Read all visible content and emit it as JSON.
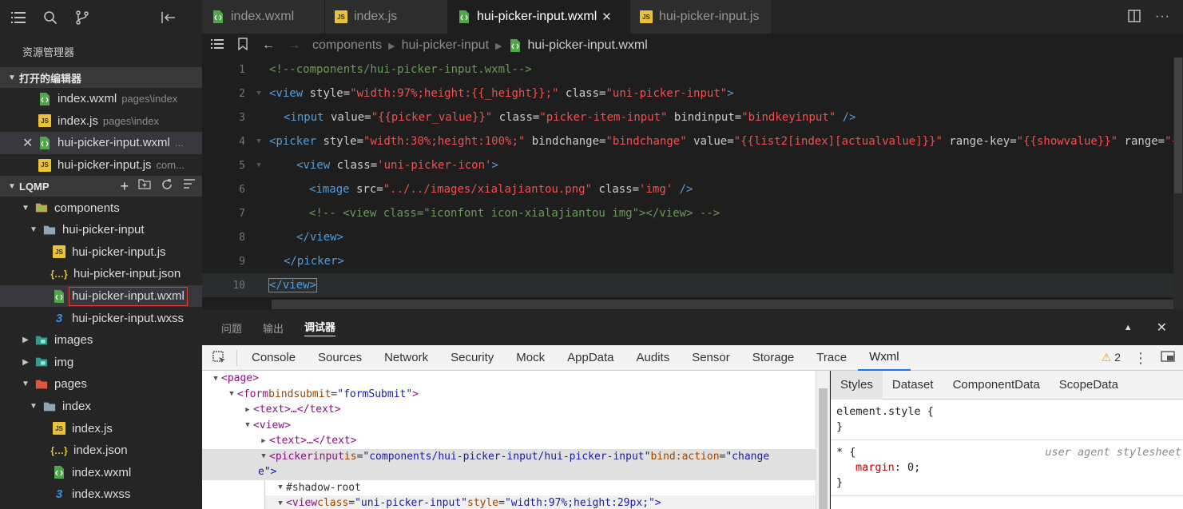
{
  "sidebar": {
    "title": "资源管理器",
    "open_editors_label": "打开的编辑器",
    "open_editors": [
      {
        "name": "index.wxml",
        "path": "pages\\index",
        "icon": "wxml-file-icon"
      },
      {
        "name": "index.js",
        "path": "pages\\index",
        "icon": "js-file-icon"
      },
      {
        "name": "hui-picker-input.wxml",
        "path": "...",
        "icon": "wxml-file-icon",
        "selected": true
      },
      {
        "name": "hui-picker-input.js",
        "path": "com...",
        "icon": "js-file-icon"
      }
    ],
    "project_label": "LQMP",
    "tree": [
      {
        "name": "components",
        "type": "folder"
      },
      {
        "name": "hui-picker-input",
        "type": "folder"
      },
      {
        "name": "hui-picker-input.js"
      },
      {
        "name": "hui-picker-input.json"
      },
      {
        "name": "hui-picker-input.wxml"
      },
      {
        "name": "hui-picker-input.wxss"
      },
      {
        "name": "images",
        "type": "folder"
      },
      {
        "name": "img",
        "type": "folder"
      },
      {
        "name": "pages",
        "type": "folder"
      },
      {
        "name": "index",
        "type": "folder"
      },
      {
        "name": "index.js"
      },
      {
        "name": "index.json"
      },
      {
        "name": "index.wxml"
      },
      {
        "name": "index.wxss"
      }
    ]
  },
  "tabs": [
    {
      "label": "index.wxml"
    },
    {
      "label": "index.js"
    },
    {
      "label": "hui-picker-input.wxml",
      "active": true
    },
    {
      "label": "hui-picker-input.js"
    }
  ],
  "breadcrumb": [
    "components",
    "hui-picker-input",
    "hui-picker-input.wxml"
  ],
  "code": {
    "line_numbers": [
      "1",
      "2",
      "3",
      "4",
      "5",
      "6",
      "7",
      "8",
      "9",
      "10"
    ],
    "l1": "<!--components/hui-picker-input.wxml-->",
    "l2": {
      "tag": "<view",
      "a1": " style=",
      "v1": "\"width:97%;height:{{_height}};\"",
      "a2": " class=",
      "v2": "\"uni-picker-input\"",
      "end": ">"
    },
    "l3": {
      "tag": "<input",
      "a1": " value=",
      "v1": "\"{{picker_value}}\"",
      "a2": " class=",
      "v2": "\"picker-item-input\"",
      "a3": " bindinput=",
      "v3": "\"bindkeyinput\"",
      "end": " />"
    },
    "l4": {
      "tag": "<picker",
      "a1": " style=",
      "v1": "\"width:30%;height:100%;\"",
      "a2": " bindchange=",
      "v2": "\"bindchange\"",
      "a3": " value=",
      "v3": "\"{{list2[index][actualvalue]}}\"",
      "a4": " range-key=",
      "v4": "\"{{showvalue}}\"",
      "a5": " range=",
      "v5": "\"{{l"
    },
    "l5": {
      "tag": "<view",
      "a1": " class=",
      "v1": "'uni-picker-icon'",
      "end": ">"
    },
    "l6": {
      "tag": "<image",
      "a1": " src=",
      "v1": "\"../../images/xialajiantou.png\"",
      "a2": " class=",
      "v2": "'img'",
      "end": " />"
    },
    "l7": "<!-- <view class=\"iconfont icon-xialajiantou img\"></view> -->",
    "l8": "</view>",
    "l9": "</picker>",
    "l10": "</view>"
  },
  "panel": {
    "tabs": [
      "问题",
      "输出",
      "调试器"
    ],
    "active": "调试器"
  },
  "devtools": {
    "tabs": [
      "Console",
      "Sources",
      "Network",
      "Security",
      "Mock",
      "AppData",
      "Audits",
      "Sensor",
      "Storage",
      "Trace",
      "Wxml"
    ],
    "active": "Wxml",
    "warning_count": "2",
    "dom": {
      "page": "<page>",
      "form_tag": "<form",
      "form_attr": "bindsubmit",
      "form_val": "\"formSubmit\"",
      "text_collapsed": "<text>…</text>",
      "view": "<view>",
      "pickerinput_tag": "<pickerinput",
      "pi_attr1": "is",
      "pi_val1": "\"components/hui-picker-input/hui-picker-input\"",
      "pi_attr2": "bind:action",
      "pi_val2": "\"change",
      "pi_wrap": "e\">",
      "shadow": "#shadow-root",
      "view2_tag": "<view",
      "v2_attr1": "class",
      "v2_val1": "\"uni-picker-input\"",
      "v2_attr2": "style",
      "v2_val2": "\"width:97%;height:29px;\">"
    },
    "styles_tabs": [
      "Styles",
      "Dataset",
      "ComponentData",
      "ScopeData"
    ],
    "styles_active": "Styles",
    "element_style": "element.style {",
    "close_brace": "}",
    "universal": "* {",
    "ua_label": "user agent stylesheet",
    "margin_prop": "margin",
    "margin_val": ": 0;"
  }
}
